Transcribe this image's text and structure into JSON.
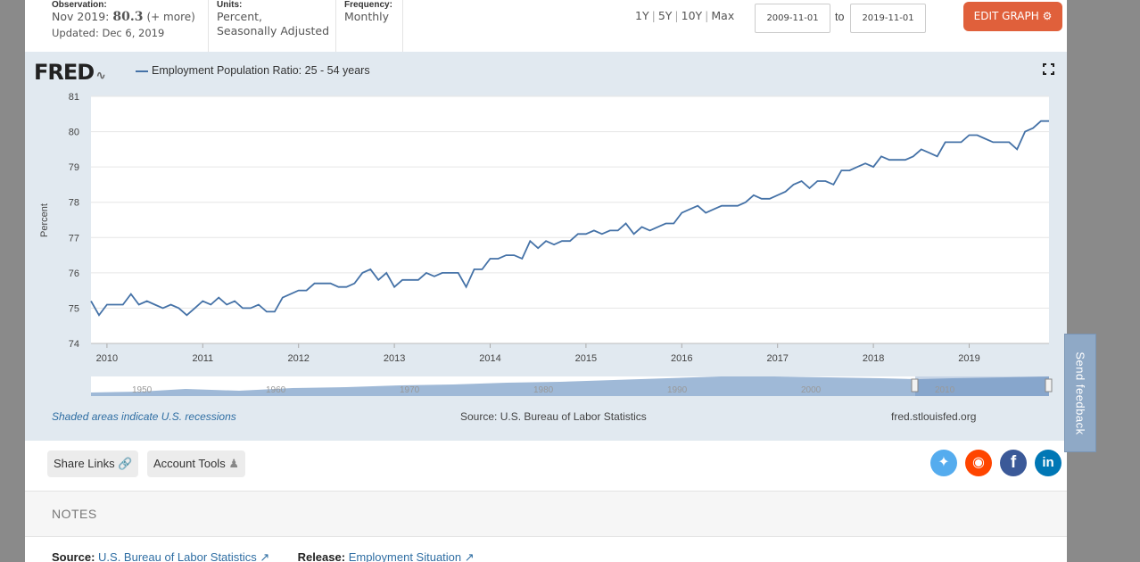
{
  "observation": {
    "label": "Observation:",
    "period": "Nov 2019:",
    "value": "80.3",
    "more": "(+ more)",
    "updated": "Updated: Dec 6, 2019"
  },
  "units": {
    "label": "Units:",
    "line1": "Percent,",
    "line2": "Seasonally Adjusted"
  },
  "frequency": {
    "label": "Frequency:",
    "value": "Monthly"
  },
  "ranges": [
    "1Y",
    "5Y",
    "10Y",
    "Max"
  ],
  "dates": {
    "from": "2009-11-01",
    "to_label": "to",
    "to": "2019-11-01"
  },
  "edit_button": "EDIT GRAPH",
  "logo": "FRED",
  "legend": "Employment Population Ratio: 25 - 54 years",
  "notes_under_chart": {
    "recessions": "Shaded areas indicate U.S. recessions",
    "source": "Source: U.S. Bureau of Labor Statistics",
    "site": "fred.stlouisfed.org"
  },
  "share": {
    "links": "Share Links",
    "account": "Account Tools"
  },
  "notes_title": "NOTES",
  "source_line": {
    "source_label": "Source:",
    "source_value": "U.S. Bureau of Labor Statistics",
    "release_label": "Release:",
    "release_value": "Employment Situation"
  },
  "feedback": "Send feedback",
  "colors": {
    "line": "#4572a7",
    "edit_button": "#e0603b",
    "panel": "#e1e9f0"
  },
  "chart_data": {
    "type": "line",
    "ylabel": "Percent",
    "ylim": [
      74,
      81
    ],
    "yticks": [
      74,
      75,
      76,
      77,
      78,
      79,
      80,
      81
    ],
    "x_start": "2009-11",
    "x_end": "2019-11",
    "xticks": [
      "2010",
      "2011",
      "2012",
      "2013",
      "2014",
      "2015",
      "2016",
      "2017",
      "2018",
      "2019"
    ],
    "navigator_labels": [
      "1950",
      "1960",
      "1970",
      "1980",
      "1990",
      "2000",
      "2010"
    ],
    "series": [
      {
        "values": [
          75.2,
          74.8,
          75.1,
          75.1,
          75.1,
          75.4,
          75.1,
          75.2,
          75.1,
          75.0,
          75.1,
          75.0,
          74.8,
          75.0,
          75.2,
          75.1,
          75.3,
          75.1,
          75.2,
          75.0,
          75.0,
          75.1,
          74.9,
          74.9,
          75.3,
          75.4,
          75.5,
          75.5,
          75.7,
          75.7,
          75.7,
          75.6,
          75.6,
          75.7,
          76.0,
          76.1,
          75.8,
          76.0,
          75.6,
          75.8,
          75.8,
          75.8,
          76.0,
          75.9,
          76.0,
          76.0,
          76.0,
          75.6,
          76.1,
          76.1,
          76.4,
          76.4,
          76.5,
          76.5,
          76.4,
          76.9,
          76.7,
          76.9,
          76.8,
          76.9,
          76.9,
          77.1,
          77.1,
          77.2,
          77.1,
          77.2,
          77.2,
          77.4,
          77.1,
          77.3,
          77.2,
          77.3,
          77.4,
          77.4,
          77.7,
          77.8,
          77.9,
          77.7,
          77.8,
          77.9,
          77.9,
          77.9,
          78.0,
          78.2,
          78.1,
          78.1,
          78.2,
          78.3,
          78.5,
          78.6,
          78.4,
          78.6,
          78.6,
          78.5,
          78.9,
          78.9,
          79.0,
          79.1,
          79.0,
          79.3,
          79.2,
          79.2,
          79.2,
          79.3,
          79.5,
          79.4,
          79.3,
          79.7,
          79.7,
          79.7,
          79.9,
          79.9,
          79.8,
          79.7,
          79.7,
          79.7,
          79.5,
          80.0,
          80.1,
          80.3,
          80.3
        ]
      }
    ],
    "grid": true
  }
}
